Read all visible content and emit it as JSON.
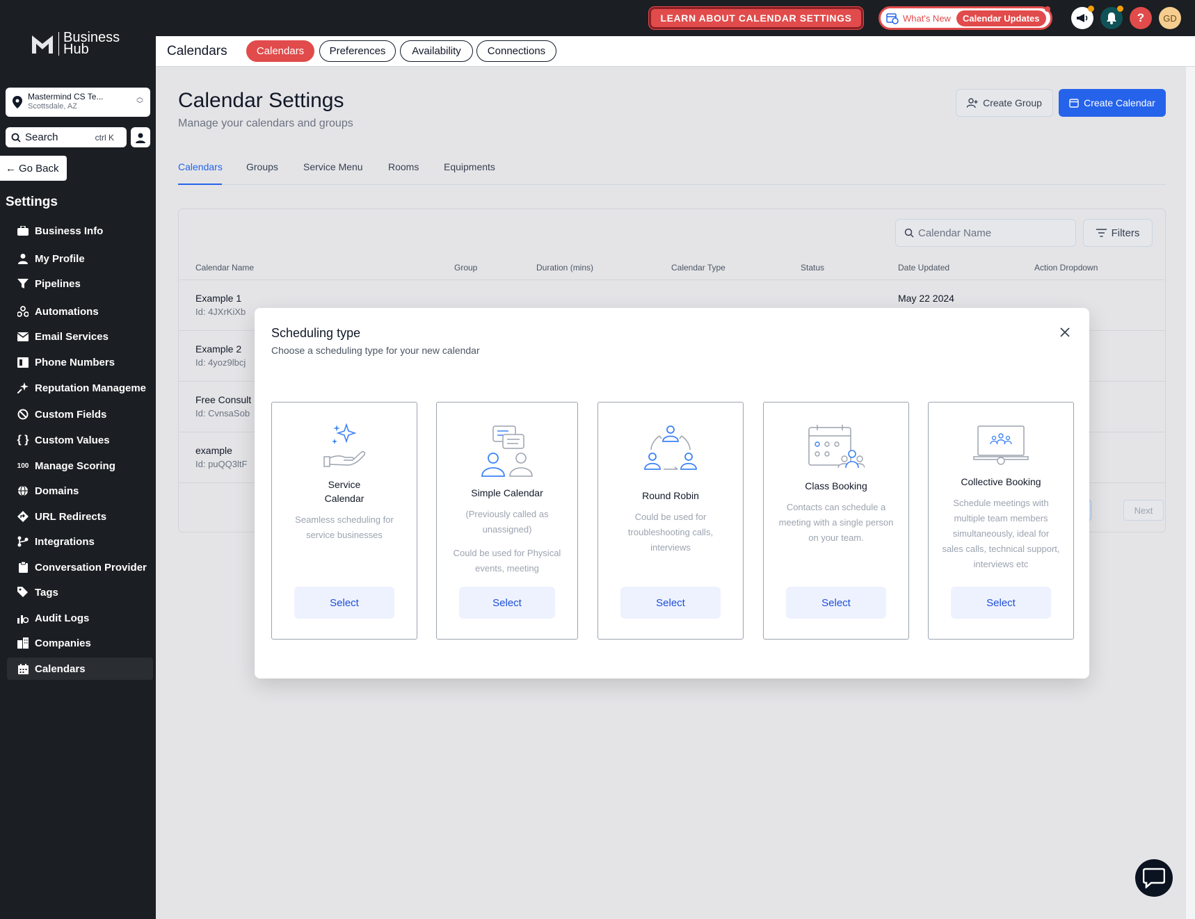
{
  "topbar": {
    "learn_button": "LEARN ABOUT CALENDAR SETTINGS",
    "whats_new": "What's New",
    "calendar_updates": "Calendar Updates",
    "avatar_initials": "GD",
    "help": "?"
  },
  "sidebar": {
    "logo_line1": "Business",
    "logo_line2": "Hub",
    "location_name": "Mastermind CS Te...",
    "location_city": "Scottsdale, AZ",
    "search_label": "Search",
    "search_shortcut": "ctrl K",
    "go_back": "Go Back",
    "settings_heading": "Settings",
    "items": [
      {
        "label": "Business Info",
        "icon": "briefcase-icon"
      },
      {
        "label": "My Profile",
        "icon": "user-icon"
      },
      {
        "label": "Pipelines",
        "icon": "filter-icon"
      },
      {
        "label": "Automations",
        "icon": "automation-icon"
      },
      {
        "label": "Email Services",
        "icon": "email-icon"
      },
      {
        "label": "Phone Numbers",
        "icon": "phone-book-icon"
      },
      {
        "label": "Reputation Manageme",
        "icon": "sparkle-icon"
      },
      {
        "label": "Custom Fields",
        "icon": "custom-fields-icon"
      },
      {
        "label": "Custom Values",
        "icon": "braces-icon"
      },
      {
        "label": "Manage Scoring",
        "icon": "scoring-icon"
      },
      {
        "label": "Domains",
        "icon": "globe-icon"
      },
      {
        "label": "URL Redirects",
        "icon": "redirect-icon"
      },
      {
        "label": "Integrations",
        "icon": "integrations-icon"
      },
      {
        "label": "Conversation Provider",
        "icon": "clipboard-icon"
      },
      {
        "label": "Tags",
        "icon": "tags-icon"
      },
      {
        "label": "Audit Logs",
        "icon": "audit-icon"
      },
      {
        "label": "Companies",
        "icon": "building-icon"
      },
      {
        "label": "Calendars",
        "icon": "calendar-icon",
        "active": true
      }
    ]
  },
  "subnav": {
    "title": "Calendars",
    "pills": [
      "Calendars",
      "Preferences",
      "Availability",
      "Connections"
    ]
  },
  "page": {
    "title": "Calendar Settings",
    "subtitle": "Manage your calendars and groups",
    "create_group": "Create Group",
    "create_calendar": "Create Calendar",
    "tabs": [
      "Calendars",
      "Groups",
      "Service Menu",
      "Rooms",
      "Equipments"
    ]
  },
  "table": {
    "search_placeholder": "Calendar Name",
    "filters": "Filters",
    "columns": [
      "Calendar Name",
      "Group",
      "Duration (mins)",
      "Calendar Type",
      "Status",
      "Date Updated",
      "Action Dropdown"
    ],
    "rows": [
      {
        "name": "Example 1",
        "id": "Id: 4JXrKiXb",
        "date": "May 22 2024"
      },
      {
        "name": "Example 2",
        "id": "Id: 4yoz9lbcj",
        "date": ""
      },
      {
        "name": "Free Consult",
        "id": "Id: CvnsaSob",
        "date": ""
      },
      {
        "name": "example",
        "id": "Id: puQQ3ltF",
        "date": ""
      }
    ],
    "next": "Next"
  },
  "modal": {
    "title": "Scheduling type",
    "subtitle": "Choose a scheduling type for your new calendar",
    "options": [
      {
        "name": "Service Calendar",
        "desc": "Seamless scheduling for service businesses",
        "select": "Select"
      },
      {
        "name": "Simple Calendar",
        "desc1": "(Previously called as unassigned)",
        "desc2": "Could be used for Physical events, meeting",
        "select": "Select"
      },
      {
        "name": "Round Robin",
        "desc": "Could be used for troubleshooting calls, interviews",
        "select": "Select"
      },
      {
        "name": "Class Booking",
        "desc": "Contacts can schedule a meeting with a single person on your team.",
        "select": "Select"
      },
      {
        "name": "Collective Booking",
        "desc": "Schedule meetings with multiple team members simultaneously, ideal for sales calls, technical support, interviews etc",
        "select": "Select"
      }
    ]
  },
  "colors": {
    "brand_red": "#e14b4b",
    "primary_blue": "#2563eb",
    "sidebar_bg": "#1b1e22"
  }
}
